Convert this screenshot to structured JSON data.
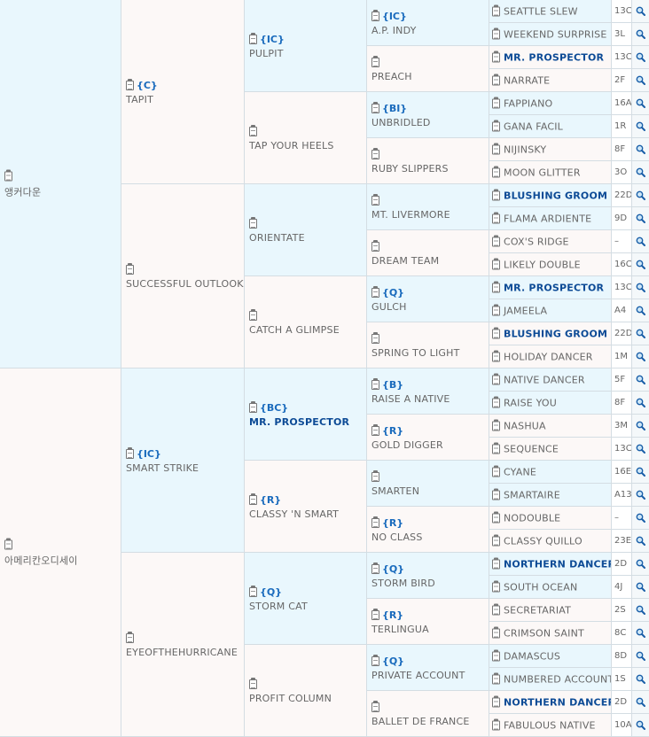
{
  "gen1": [
    {
      "name": "앵커다운",
      "code": "",
      "bg": "blue"
    },
    {
      "name": "아메리칸오디세이",
      "code": "",
      "bg": "pink"
    }
  ],
  "gen2": [
    {
      "name": "TAPIT",
      "code": "{C}",
      "bg": "pink"
    },
    {
      "name": "SUCCESSFUL OUTLOOK",
      "code": "",
      "bg": "pink"
    },
    {
      "name": "SMART STRIKE",
      "code": "{IC}",
      "bg": "blue"
    },
    {
      "name": "EYEOFTHEHURRICANE",
      "code": "",
      "bg": "pink"
    }
  ],
  "gen3": [
    {
      "name": "PULPIT",
      "code": "{IC}",
      "bg": "blue"
    },
    {
      "name": "TAP YOUR HEELS",
      "code": "",
      "bg": "pink"
    },
    {
      "name": "ORIENTATE",
      "code": "",
      "bg": "blue"
    },
    {
      "name": "CATCH A GLIMPSE",
      "code": "",
      "bg": "pink"
    },
    {
      "name": "MR. PROSPECTOR",
      "code": "{BC}",
      "bg": "blue",
      "hl": true
    },
    {
      "name": "CLASSY 'N SMART",
      "code": "{R}",
      "bg": "pink"
    },
    {
      "name": "STORM CAT",
      "code": "{Q}",
      "bg": "blue"
    },
    {
      "name": "PROFIT COLUMN",
      "code": "",
      "bg": "pink"
    }
  ],
  "gen4": [
    {
      "name": "A.P. INDY",
      "code": "{IC}",
      "bg": "blue"
    },
    {
      "name": "PREACH",
      "code": "",
      "bg": "pink"
    },
    {
      "name": "UNBRIDLED",
      "code": "{BI}",
      "bg": "blue"
    },
    {
      "name": "RUBY SLIPPERS",
      "code": "",
      "bg": "pink"
    },
    {
      "name": "MT. LIVERMORE",
      "code": "",
      "bg": "blue"
    },
    {
      "name": "DREAM TEAM",
      "code": "",
      "bg": "pink"
    },
    {
      "name": "GULCH",
      "code": "{Q}",
      "bg": "blue"
    },
    {
      "name": "SPRING TO LIGHT",
      "code": "",
      "bg": "pink"
    },
    {
      "name": "RAISE A NATIVE",
      "code": "{B}",
      "bg": "blue"
    },
    {
      "name": "GOLD DIGGER",
      "code": "{R}",
      "bg": "pink"
    },
    {
      "name": "SMARTEN",
      "code": "",
      "bg": "blue"
    },
    {
      "name": "NO CLASS",
      "code": "{R}",
      "bg": "pink"
    },
    {
      "name": "STORM BIRD",
      "code": "{Q}",
      "bg": "blue"
    },
    {
      "name": "TERLINGUA",
      "code": "{R}",
      "bg": "pink"
    },
    {
      "name": "PRIVATE ACCOUNT",
      "code": "{Q}",
      "bg": "blue"
    },
    {
      "name": "BALLET DE FRANCE",
      "code": "",
      "bg": "pink"
    }
  ],
  "gen5": [
    {
      "name": "SEATTLE SLEW",
      "hl": false,
      "extra": "13C"
    },
    {
      "name": "WEEKEND SURPRISE",
      "hl": false,
      "extra": "3L"
    },
    {
      "name": "MR. PROSPECTOR",
      "hl": true,
      "extra": "13C"
    },
    {
      "name": "NARRATE",
      "hl": false,
      "extra": "2F"
    },
    {
      "name": "FAPPIANO",
      "hl": false,
      "extra": "16A"
    },
    {
      "name": "GANA FACIL",
      "hl": false,
      "extra": "1R"
    },
    {
      "name": "NIJINSKY",
      "hl": false,
      "extra": "8F"
    },
    {
      "name": "MOON GLITTER",
      "hl": false,
      "extra": "3O"
    },
    {
      "name": "BLUSHING GROOM",
      "hl": true,
      "extra": "22D"
    },
    {
      "name": "FLAMA ARDIENTE",
      "hl": false,
      "extra": "9D"
    },
    {
      "name": "COX'S RIDGE",
      "hl": false,
      "extra": "–"
    },
    {
      "name": "LIKELY DOUBLE",
      "hl": false,
      "extra": "16C"
    },
    {
      "name": "MR. PROSPECTOR",
      "hl": true,
      "extra": "13C"
    },
    {
      "name": "JAMEELA",
      "hl": false,
      "extra": "A4"
    },
    {
      "name": "BLUSHING GROOM",
      "hl": true,
      "extra": "22D"
    },
    {
      "name": "HOLIDAY DANCER",
      "hl": false,
      "extra": "1M"
    },
    {
      "name": "NATIVE DANCER",
      "hl": false,
      "extra": "5F"
    },
    {
      "name": "RAISE YOU",
      "hl": false,
      "extra": "8F"
    },
    {
      "name": "NASHUA",
      "hl": false,
      "extra": "3M"
    },
    {
      "name": "SEQUENCE",
      "hl": false,
      "extra": "13C"
    },
    {
      "name": "CYANE",
      "hl": false,
      "extra": "16E"
    },
    {
      "name": "SMARTAIRE",
      "hl": false,
      "extra": "A13"
    },
    {
      "name": "NODOUBLE",
      "hl": false,
      "extra": "–"
    },
    {
      "name": "CLASSY QUILLO",
      "hl": false,
      "extra": "23E"
    },
    {
      "name": "NORTHERN DANCER",
      "hl": true,
      "extra": "2D"
    },
    {
      "name": "SOUTH OCEAN",
      "hl": false,
      "extra": "4J"
    },
    {
      "name": "SECRETARIAT",
      "hl": false,
      "extra": "2S"
    },
    {
      "name": "CRIMSON SAINT",
      "hl": false,
      "extra": "8C"
    },
    {
      "name": "DAMASCUS",
      "hl": false,
      "extra": "8D"
    },
    {
      "name": "NUMBERED ACCOUNT",
      "hl": false,
      "extra": "1S"
    },
    {
      "name": "NORTHERN DANCER",
      "hl": true,
      "extra": "2D"
    },
    {
      "name": "FABULOUS NATIVE",
      "hl": false,
      "extra": "10A"
    }
  ],
  "colors": {
    "blue_cell": "#e9f7fd",
    "pink_cell": "#fcf8f7",
    "code_blue": "#1a6bbd",
    "highlight_name": "#0d4b96",
    "text_gray": "#666666",
    "border": "#d4dde3"
  },
  "icons": {
    "pedigree_icon": "clipboard-icon",
    "search_icon": "magnifier-icon"
  }
}
